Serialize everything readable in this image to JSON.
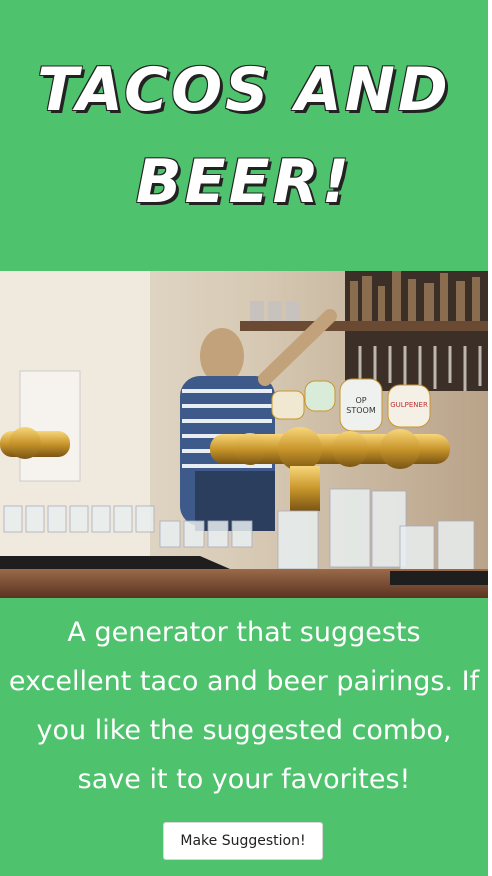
{
  "header": {
    "title": "TACOS AND BEER!"
  },
  "hero_image": {
    "description_icon": "bar-beer-taps-image",
    "tap_labels": [
      "OP STOOM",
      "GULPENER"
    ]
  },
  "main": {
    "tagline": "A generator that suggests excellent taco and beer pairings. If you like the suggested combo, save it to your favorites!",
    "suggest_button_label": "Make Suggestion!"
  },
  "colors": {
    "background": "#4ec26c",
    "text": "#ffffff"
  }
}
